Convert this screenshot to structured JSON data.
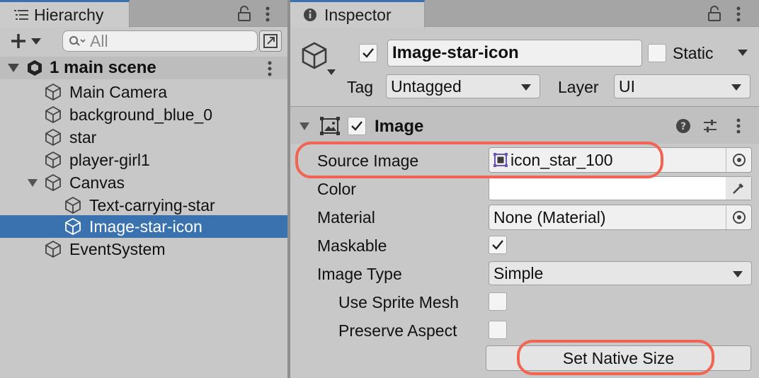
{
  "hierarchy": {
    "tab_title": "Hierarchy",
    "search_placeholder": "All",
    "scene_name": "1 main scene",
    "items": [
      {
        "label": "Main Camera"
      },
      {
        "label": "background_blue_0"
      },
      {
        "label": "star"
      },
      {
        "label": "player-girl1"
      },
      {
        "label": "Canvas"
      },
      {
        "label": "Text-carrying-star"
      },
      {
        "label": "Image-star-icon"
      },
      {
        "label": "EventSystem"
      }
    ],
    "selected_item": "Image-star-icon",
    "selection_color": "#3a72b0"
  },
  "inspector": {
    "tab_title": "Inspector",
    "object_name": "Image-star-icon",
    "static_label": "Static",
    "tag_label": "Tag",
    "tag_value": "Untagged",
    "layer_label": "Layer",
    "layer_value": "UI",
    "component": {
      "title": "Image",
      "fields": {
        "source_image_label": "Source Image",
        "source_image_value": "icon_star_100",
        "color_label": "Color",
        "material_label": "Material",
        "material_value": "None (Material)",
        "maskable_label": "Maskable",
        "image_type_label": "Image Type",
        "image_type_value": "Simple",
        "use_sprite_mesh_label": "Use Sprite Mesh",
        "preserve_aspect_label": "Preserve Aspect"
      },
      "set_native_size_label": "Set Native Size"
    },
    "highlight_color": "#f26352"
  }
}
